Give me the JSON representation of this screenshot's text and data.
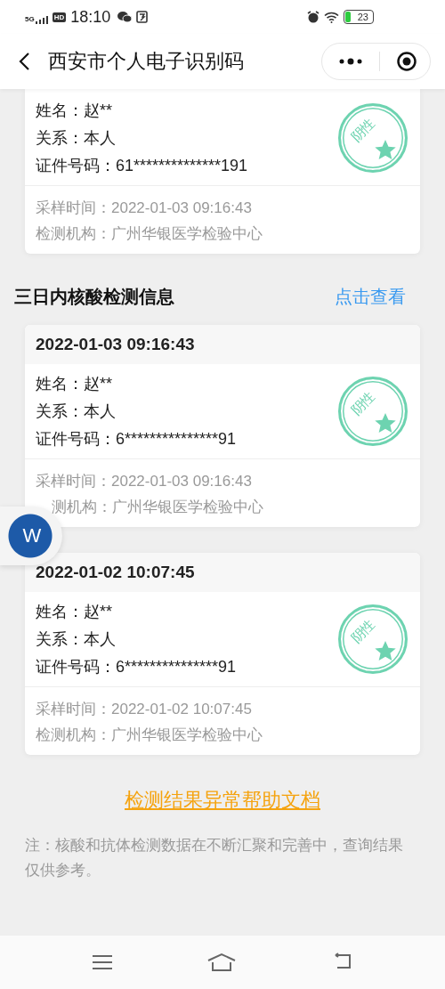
{
  "status_bar": {
    "network": "5G",
    "hd": "HD",
    "time": "18:10",
    "battery": "23"
  },
  "nav": {
    "title": "西安市个人电子识别码"
  },
  "current_card": {
    "fields": [
      {
        "label": "姓名：",
        "value": "赵**"
      },
      {
        "label": "关系：",
        "value": "本人"
      },
      {
        "label": "证件号码：",
        "value": "61**************191"
      }
    ],
    "result": "阴性",
    "footer": [
      {
        "label": "采样时间：",
        "value": "2022-01-03 09:16:43",
        "partly_hidden": false
      },
      {
        "label": "检测机构：",
        "value": "广州华银医学检验中心",
        "partly_hidden": false
      }
    ]
  },
  "section": {
    "title": "三日内核酸检测信息",
    "action": "点击查看"
  },
  "records": [
    {
      "datetime": "2022-01-03 09:16:43",
      "fields": [
        {
          "label": "姓名：",
          "value": "赵**"
        },
        {
          "label": "关系：",
          "value": "本人"
        },
        {
          "label": "证件号码：",
          "value": "6***************91"
        }
      ],
      "result": "阴性",
      "footer": [
        {
          "label": "采样时间：",
          "value": "2022-01-03 09:16:43",
          "partly_hidden": false
        },
        {
          "label": "测机构：",
          "value": "广州华银医学检验中心",
          "partly_hidden": true
        }
      ]
    },
    {
      "datetime": "2022-01-02 10:07:45",
      "fields": [
        {
          "label": "姓名：",
          "value": "赵**"
        },
        {
          "label": "关系：",
          "value": "本人"
        },
        {
          "label": "证件号码：",
          "value": "6***************91"
        }
      ],
      "result": "阴性",
      "footer": [
        {
          "label": "采样时间：",
          "value": "2022-01-02 10:07:45",
          "partly_hidden": false
        },
        {
          "label": "检测机构：",
          "value": "广州华银医学检验中心",
          "partly_hidden": false
        }
      ]
    }
  ],
  "floating_button": {
    "label": "W"
  },
  "help_link": "检测结果异常帮助文档",
  "note": "注：核酸和抗体检测数据在不断汇聚和完善中，查询结果仅供参考。"
}
